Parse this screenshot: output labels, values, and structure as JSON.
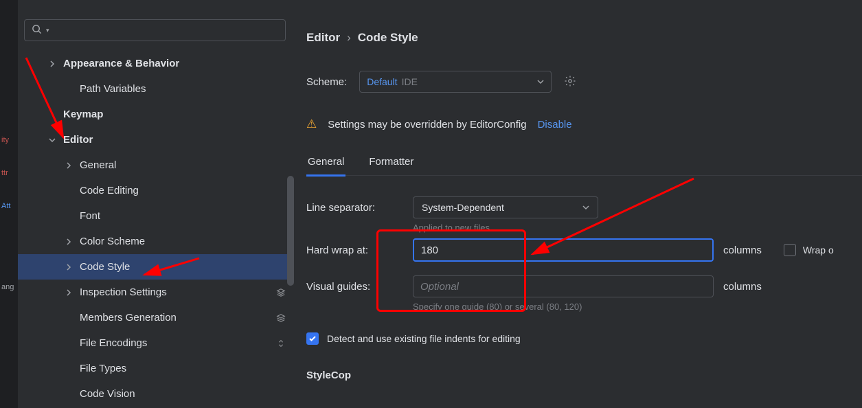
{
  "left_edge": {
    "line1": "ity",
    "line2": "ttr",
    "line3": "Att",
    "line4": "ang"
  },
  "search": {
    "placeholder": ""
  },
  "sidebar": {
    "items": [
      {
        "label": "Appearance & Behavior",
        "indent": 44,
        "chevron": "right",
        "bold": true
      },
      {
        "label": "Path Variables",
        "indent": 68,
        "chevron": "none"
      },
      {
        "label": "Keymap",
        "indent": 44,
        "chevron": "none",
        "bold": true
      },
      {
        "label": "Editor",
        "indent": 44,
        "chevron": "down",
        "bold": true
      },
      {
        "label": "General",
        "indent": 68,
        "chevron": "right"
      },
      {
        "label": "Code Editing",
        "indent": 68,
        "chevron": "none"
      },
      {
        "label": "Font",
        "indent": 68,
        "chevron": "none"
      },
      {
        "label": "Color Scheme",
        "indent": 68,
        "chevron": "right"
      },
      {
        "label": "Code Style",
        "indent": 68,
        "chevron": "right",
        "selected": true
      },
      {
        "label": "Inspection Settings",
        "indent": 68,
        "chevron": "right",
        "right_icon": "layers"
      },
      {
        "label": "Members Generation",
        "indent": 68,
        "chevron": "none",
        "right_icon": "layers"
      },
      {
        "label": "File Encodings",
        "indent": 68,
        "chevron": "none",
        "right_icon": "up-down"
      },
      {
        "label": "File Types",
        "indent": 68,
        "chevron": "none"
      },
      {
        "label": "Code Vision",
        "indent": 68,
        "chevron": "none"
      }
    ]
  },
  "breadcrumb": {
    "part1": "Editor",
    "part2": "Code Style"
  },
  "scheme": {
    "label": "Scheme:",
    "value_default": "Default",
    "value_ide": "IDE"
  },
  "warning": {
    "text": "Settings may be overridden by EditorConfig",
    "link": "Disable"
  },
  "tabs": {
    "general": "General",
    "formatter": "Formatter"
  },
  "form": {
    "line_separator_label": "Line separator:",
    "line_separator_value": "System-Dependent",
    "applied_hint": "Applied to new files",
    "hard_wrap_label": "Hard wrap at:",
    "hard_wrap_value": "180",
    "columns": "columns",
    "wrap_checkbox": "Wrap o",
    "visual_guides_label": "Visual guides:",
    "visual_guides_placeholder": "Optional",
    "visual_guides_hint": "Specify one guide (80) or several (80, 120)",
    "detect_checkbox": "Detect and use existing file indents for editing",
    "stylecop": "StyleCop"
  }
}
